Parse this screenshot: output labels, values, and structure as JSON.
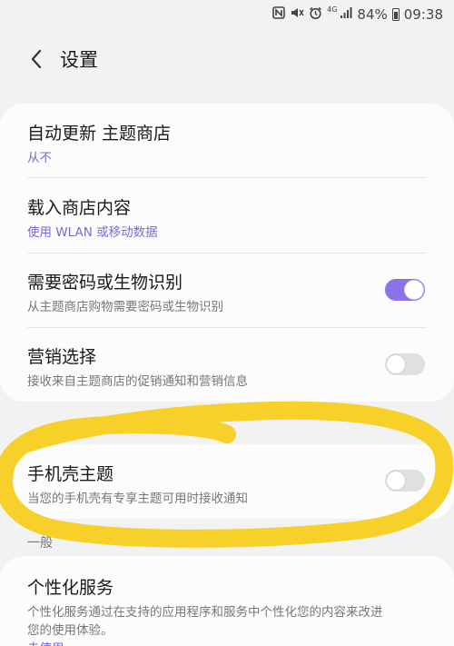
{
  "status_bar": {
    "network_type": "4G",
    "battery": "84%",
    "time": "09:38",
    "icons": [
      "nfc-icon",
      "mute-vibrate-icon",
      "alarm-icon",
      "signal-icon",
      "battery-icon"
    ]
  },
  "header": {
    "title": "设置"
  },
  "settings": [
    {
      "title": "自动更新 主题商店",
      "subtitle": "从不",
      "subtitle_accent": true
    },
    {
      "title": "载入商店内容",
      "subtitle": "使用 WLAN 或移动数据",
      "subtitle_accent": true
    },
    {
      "title": "需要密码或生物识别",
      "subtitle": "从主题商店购物需要密码或生物识别",
      "toggle": true
    },
    {
      "title": "营销选择",
      "subtitle": "接收来自主题商店的促销通知和营销信息",
      "toggle": false
    }
  ],
  "case_theme": {
    "title": "手机壳主题",
    "subtitle": "当您的手机壳有专享主题可用时接收通知",
    "toggle": false
  },
  "general_section": {
    "header": "一般",
    "items": [
      {
        "title": "个性化服务",
        "subtitle_line1": "个性化服务通过在支持的应用程序和服务中个性化您的内容来改进",
        "subtitle_line2": "您的使用体验。",
        "subtitle_line3": "未使用"
      }
    ]
  },
  "colors": {
    "accent": "#7b6bd1",
    "toggle_on": "#8b72e6",
    "highlight": "#f7cd1f"
  }
}
